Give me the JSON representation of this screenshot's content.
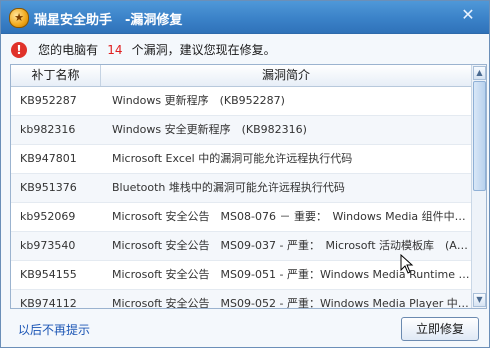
{
  "window": {
    "title": "瑞星安全助手　-漏洞修复",
    "app_icon_glyph": "★",
    "close_glyph": "✕"
  },
  "warning": {
    "prefix": "您的电脑有",
    "count": "14",
    "suffix": "个漏洞，建议您现在修复。",
    "count_color": "#e02020"
  },
  "table": {
    "headers": {
      "id": "补丁名称",
      "desc": "漏洞简介"
    },
    "rows": [
      {
        "id": "KB952287",
        "desc": "Windows 更新程序　(KB952287)"
      },
      {
        "id": "kb982316",
        "desc": "Windows 安全更新程序　(KB982316)"
      },
      {
        "id": "KB947801",
        "desc": "Microsoft Excel 中的漏洞可能允许远程执行代码"
      },
      {
        "id": "KB951376",
        "desc": "Bluetooth 堆栈中的漏洞可能允许远程执行代码"
      },
      {
        "id": "kb952069",
        "desc": "Microsoft 安全公告　MS08-076 － 重要：　Windows Media 组件中…"
      },
      {
        "id": "kb973540",
        "desc": "Microsoft 安全公告　MS09-037 - 严重：　Microsoft 活动模板库　(A…"
      },
      {
        "id": "KB954155",
        "desc": "Microsoft 安全公告　MS09-051 - 严重：Windows Media Runtime …"
      },
      {
        "id": "KB974112",
        "desc": "Microsoft 安全公告　MS09-052 - 严重：Windows Media Player 中…"
      }
    ]
  },
  "footer": {
    "no_remind_label": "以后不再提示",
    "fix_button_label": "立即修复"
  },
  "scrollbar": {
    "up_glyph": "▲",
    "down_glyph": "▼"
  }
}
